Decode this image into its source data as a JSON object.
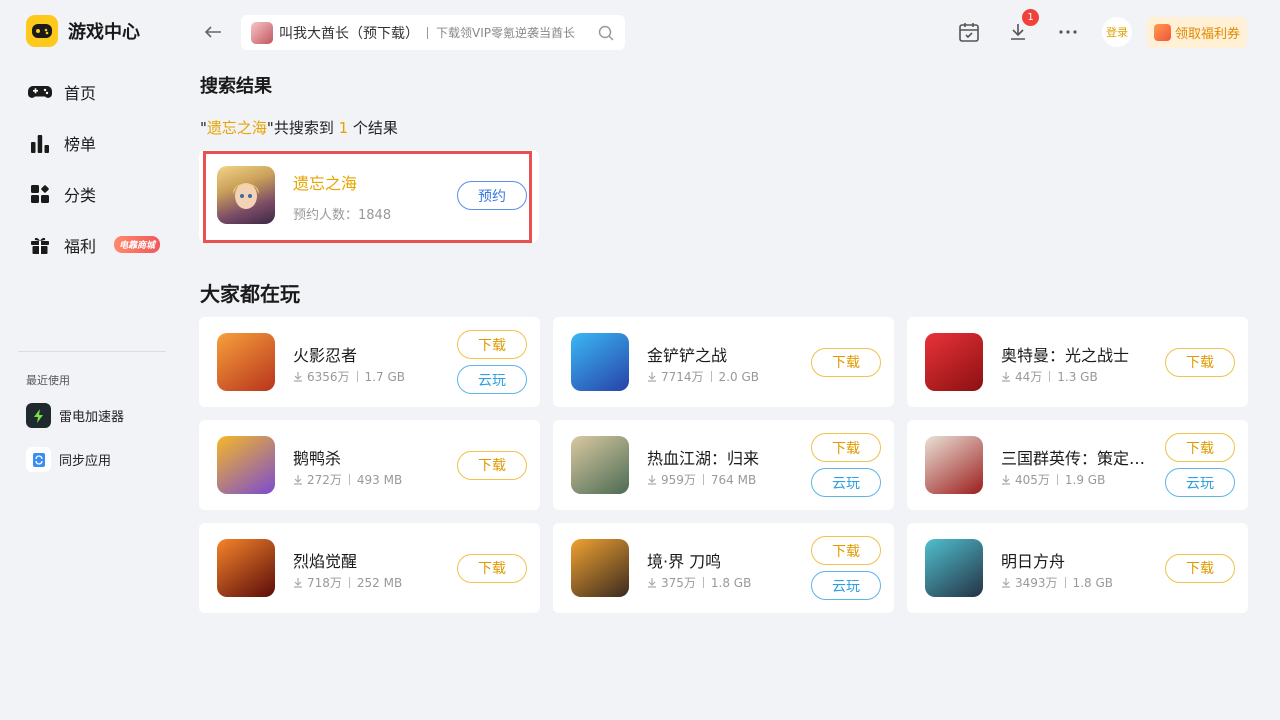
{
  "app": {
    "title": "游戏中心"
  },
  "nav": [
    {
      "label": "首页",
      "icon": "gamepad-icon"
    },
    {
      "label": "榜单",
      "icon": "ranking-icon"
    },
    {
      "label": "分类",
      "icon": "category-icon"
    },
    {
      "label": "福利",
      "icon": "gift-icon",
      "badge": "电靠商城"
    }
  ],
  "recent": {
    "title": "最近使用",
    "items": [
      {
        "label": "雷电加速器",
        "icon": "thunder-accelerator-icon",
        "color": "#1f2a2e"
      },
      {
        "label": "同步应用",
        "icon": "sync-app-icon",
        "color": "#3a8ef0"
      }
    ]
  },
  "search": {
    "value": "叫我大酋长（预下载）",
    "hint": "下载领VIP零氪逆袭当酋长"
  },
  "topbar": {
    "download_count": "1",
    "login_label": "登录",
    "coupon_label": "领取福利券"
  },
  "results": {
    "title": "搜索结果",
    "summary_prefix": "\"",
    "keyword": "遗忘之海",
    "summary_mid": "\"共搜索到 ",
    "count": "1",
    "summary_suffix": " 个结果",
    "item": {
      "name": "遗忘之海",
      "meta": "预约人数：1848",
      "button": "预约"
    }
  },
  "popular": {
    "title": "大家都在玩",
    "download_label": "下载",
    "cloud_label": "云玩",
    "games": [
      {
        "name": "火影忍者",
        "downloads": "6356万",
        "size": "1.7 GB",
        "cloud": true,
        "colors": [
          "#f7a03b",
          "#b8341d"
        ]
      },
      {
        "name": "金铲铲之战",
        "downloads": "7714万",
        "size": "2.0 GB",
        "cloud": false,
        "colors": [
          "#3bb8f5",
          "#2742a8"
        ]
      },
      {
        "name": "奥特曼：光之战士",
        "downloads": "44万",
        "size": "1.3 GB",
        "cloud": false,
        "colors": [
          "#e8333a",
          "#8b1010"
        ]
      },
      {
        "name": "鹅鸭杀",
        "downloads": "272万",
        "size": "493 MB",
        "cloud": false,
        "colors": [
          "#f5b828",
          "#7a4bd0"
        ]
      },
      {
        "name": "热血江湖：归来",
        "downloads": "959万",
        "size": "764 MB",
        "cloud": true,
        "colors": [
          "#d9c9a0",
          "#4b6b54"
        ]
      },
      {
        "name": "三国群英传：策定九州",
        "downloads": "405万",
        "size": "1.9 GB",
        "cloud": true,
        "colors": [
          "#e9e2d6",
          "#9c1d1d"
        ]
      },
      {
        "name": "烈焰觉醒",
        "downloads": "718万",
        "size": "252 MB",
        "cloud": false,
        "colors": [
          "#f5852a",
          "#5a0b0b"
        ]
      },
      {
        "name": "境·界 刀鸣",
        "downloads": "375万",
        "size": "1.8 GB",
        "cloud": true,
        "colors": [
          "#f0a231",
          "#3a2a1f"
        ]
      },
      {
        "name": "明日方舟",
        "downloads": "3493万",
        "size": "1.8 GB",
        "cloud": false,
        "colors": [
          "#4fc0cf",
          "#253244"
        ]
      }
    ]
  }
}
